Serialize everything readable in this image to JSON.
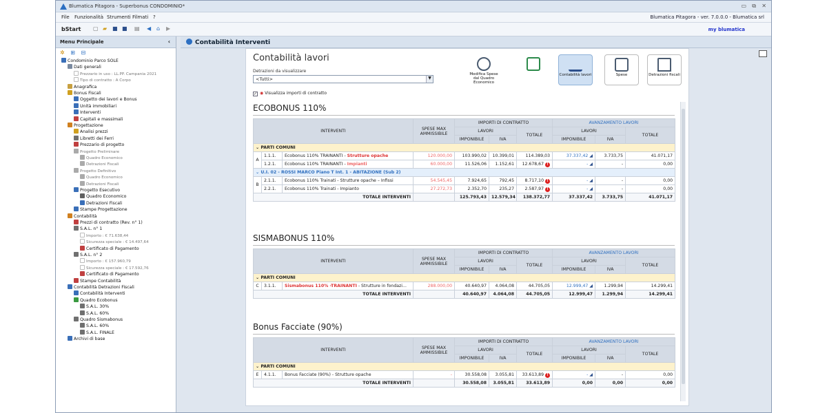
{
  "window": {
    "title": "Blumatica Pitagora - Superbonus CONDOMINIO*",
    "min": "▭",
    "restore": "⧉",
    "close": "✕"
  },
  "menu": {
    "items": [
      "File",
      "Funzionalità",
      "Strumenti",
      "Filmati",
      "?"
    ],
    "version": "Blumatica Pitagora - ver. 7.0.0.0 - Blumatica srl"
  },
  "toolbar": {
    "start_label": "bStart",
    "brand": "my blumatica"
  },
  "sidebar": {
    "title": "Menu Principale",
    "tree": [
      {
        "t": "Condominio Parco SOLE",
        "d": 0,
        "c": "#3a6fb8"
      },
      {
        "t": "Dati generali",
        "d": 1,
        "c": "#7a8aa0"
      },
      {
        "t": "Prezzario in uso : LL.PP. Campania 2021",
        "d": 2,
        "dim": true
      },
      {
        "t": "Tipo di contratto : A Corpo",
        "d": 2,
        "dim": true
      },
      {
        "t": "Anagrafica",
        "d": 1,
        "c": "#c8a040"
      },
      {
        "t": "Bonus Fiscali",
        "d": 1,
        "c": "#d0a020"
      },
      {
        "t": "Oggetto dei lavori e Bonus",
        "d": 2,
        "c": "#3a6fb8"
      },
      {
        "t": "Unità immobiliari",
        "d": 2,
        "c": "#3a6fb8"
      },
      {
        "t": "Interventi",
        "d": 2,
        "c": "#3a6fb8"
      },
      {
        "t": "Capitali e massimali",
        "d": 2,
        "c": "#c04040"
      },
      {
        "t": "Progettazione",
        "d": 1,
        "c": "#d08020"
      },
      {
        "t": "Analisi prezzi",
        "d": 2,
        "c": "#d0a020"
      },
      {
        "t": "Libretti dei Ferri",
        "d": 2,
        "c": "#707070"
      },
      {
        "t": "Prezzario di progetto",
        "d": 2,
        "c": "#c04040"
      },
      {
        "t": "Progetto Preliminare",
        "d": 2,
        "dim": true,
        "c": "#aaa"
      },
      {
        "t": "Quadro Economico",
        "d": 3,
        "dim": true,
        "c": "#aaa"
      },
      {
        "t": "Detrazioni Fiscali",
        "d": 3,
        "dim": true,
        "c": "#aaa"
      },
      {
        "t": "Progetto Definitivo",
        "d": 2,
        "dim": true,
        "c": "#aaa"
      },
      {
        "t": "Quadro Economico",
        "d": 3,
        "dim": true,
        "c": "#aaa"
      },
      {
        "t": "Detrazioni Fiscali",
        "d": 3,
        "dim": true,
        "c": "#aaa"
      },
      {
        "t": "Progetto Esecutivo",
        "d": 2,
        "c": "#3a6fb8"
      },
      {
        "t": "Quadro Economico",
        "d": 3,
        "c": "#606060"
      },
      {
        "t": "Detrazioni Fiscali",
        "d": 3,
        "c": "#3a6fb8"
      },
      {
        "t": "Stampe Progettazione",
        "d": 2,
        "c": "#3a6fb8"
      },
      {
        "t": "Contabilità",
        "d": 1,
        "c": "#d08020"
      },
      {
        "t": "Prezzi di contratto (Rev. n° 1)",
        "d": 2,
        "c": "#c04040"
      },
      {
        "t": "S.A.L. n° 1",
        "d": 2,
        "c": "#707070"
      },
      {
        "t": "Importo : € 71.638,44",
        "d": 3,
        "dim": true
      },
      {
        "t": "Sicurezza speciale : € 14.497,64",
        "d": 3,
        "dim": true
      },
      {
        "t": "Certificato di Pagamento",
        "d": 3,
        "c": "#c04040"
      },
      {
        "t": "S.A.L. n° 2",
        "d": 2,
        "c": "#707070"
      },
      {
        "t": "Importo : € 157.960,79",
        "d": 3,
        "dim": true
      },
      {
        "t": "Sicurezza speciale : € 17.592,76",
        "d": 3,
        "dim": true
      },
      {
        "t": "Certificato di Pagamento",
        "d": 3,
        "c": "#c04040"
      },
      {
        "t": "Stampe Contabilità",
        "d": 2,
        "c": "#c04040"
      },
      {
        "t": "Contabilità Detrazioni Fiscali",
        "d": 1,
        "c": "#3a6fb8"
      },
      {
        "t": "Contabilità Interventi",
        "d": 2,
        "c": "#3a6fb8"
      },
      {
        "t": "Quadro Ecobonus",
        "d": 2,
        "c": "#3a9a40"
      },
      {
        "t": "S.A.L. 30%",
        "d": 3,
        "c": "#707070"
      },
      {
        "t": "S.A.L. 60%",
        "d": 3,
        "c": "#707070"
      },
      {
        "t": "Quadro Sismabonus",
        "d": 2,
        "c": "#707070"
      },
      {
        "t": "S.A.L. 60%",
        "d": 3,
        "c": "#707070"
      },
      {
        "t": "S.A.L. FINALE",
        "d": 3,
        "c": "#707070"
      },
      {
        "t": "Archivi di base",
        "d": 1,
        "c": "#3a6fb8"
      }
    ]
  },
  "main": {
    "header": "Contabilità Interventi",
    "title": "Contabilità lavori",
    "detrazioni_label": "Detrazioni da visualizzare",
    "detrazioni_value": "<Tutti>",
    "show_contract": "Visualizza importi di contratto",
    "tools": [
      {
        "label": "Modifica Spese dal Quadro Economico"
      },
      {
        "label": ""
      },
      {
        "label": "Contabilità lavori",
        "selected": true
      },
      {
        "label": "Spese"
      },
      {
        "label": "Detrazioni fiscali"
      }
    ]
  },
  "headers": {
    "interventi": "INTERVENTI",
    "spese_max": "SPESE MAX AMMISSIBILE",
    "importi": "IMPORTI DI CONTRATTO",
    "avanzamento": "AVANZAMENTO LAVORI",
    "lavori": "LAVORI",
    "imponibile": "IMPONIBILE",
    "iva": "IVA",
    "totale": "TOTALE",
    "totale_interventi": "TOTALE INTERVENTI"
  },
  "sections": [
    {
      "title": "ECOBONUS 110%",
      "groups": [
        {
          "label": "PARTI COMUNI",
          "kind": "yellow",
          "letter": "A",
          "rows": [
            {
              "code": "1.1.1.",
              "desc": "Ecobonus 110% TRAINANTI - ",
              "desc2": "Strutture opache",
              "c2": "red",
              "max": "120.000,00",
              "imp": "103.990,02",
              "iva": "10.399,01",
              "tot": "114.389,03",
              "warn": false,
              "aimp": "37.337,42",
              "aiva": "3.733,75",
              "atot": "41.071,17"
            },
            {
              "code": "1.2.1.",
              "desc": "Ecobonus 110% TRAINANTI - ",
              "desc2": "Impianti",
              "c2": "pink",
              "max": "60.000,00",
              "imp": "11.526,06",
              "iva": "1.152,61",
              "tot": "12.678,67",
              "warn": true,
              "aimp": "-",
              "aiva": "-",
              "atot": "0,00"
            }
          ]
        },
        {
          "label": "U.I. 02 - ROSSI MARCO Piano T Int. 1 - ABITAZIONE (Sub 2)",
          "kind": "blue",
          "letter": "B",
          "rows": [
            {
              "code": "2.1.1.",
              "desc": "Ecobonus 110% Trainati - Strutture opache – Infissi",
              "desc2": "",
              "c2": "",
              "max": "54.545,45",
              "imp": "7.924,65",
              "iva": "792,45",
              "tot": "8.717,10",
              "warn": true,
              "aimp": "-",
              "aiva": "-",
              "atot": "0,00"
            },
            {
              "code": "2.2.1.",
              "desc": "Ecobonus 110% Trainati - Impianto",
              "desc2": "",
              "c2": "",
              "max": "27.272,73",
              "imp": "2.352,70",
              "iva": "235,27",
              "tot": "2.587,97",
              "warn": true,
              "aimp": "-",
              "aiva": "-",
              "atot": "0,00"
            }
          ]
        }
      ],
      "total": {
        "imp": "125.793,43",
        "iva": "12.579,34",
        "tot": "138.372,77",
        "aimp": "37.337,42",
        "aiva": "3.733,75",
        "atot": "41.071,17"
      }
    },
    {
      "title": "SISMABONUS 110%",
      "groups": [
        {
          "label": "PARTI COMUNI",
          "kind": "yellow",
          "letter": "C",
          "rows": [
            {
              "code": "3.1.1.",
              "desc": "",
              "desc2": "Sismabonus 110% -TRAINANTI",
              "c2": "red",
              "desc3": " - Strutture in fondazi...",
              "max": "288.000,00",
              "imp": "40.640,97",
              "iva": "4.064,08",
              "tot": "44.705,05",
              "warn": false,
              "aimp": "12.999,47",
              "aiva": "1.299,94",
              "atot": "14.299,41"
            }
          ]
        }
      ],
      "total": {
        "imp": "40.640,97",
        "iva": "4.064,08",
        "tot": "44.705,05",
        "aimp": "12.999,47",
        "aiva": "1.299,94",
        "atot": "14.299,41"
      }
    },
    {
      "title": "Bonus Facciate (90%)",
      "groups": [
        {
          "label": "PARTI COMUNI",
          "kind": "yellow",
          "letter": "E",
          "rows": [
            {
              "code": "4.1.1.",
              "desc": "Bonus Facciate (90%) - Strutture opache",
              "desc2": "",
              "c2": "",
              "max": "-",
              "imp": "30.558,08",
              "iva": "3.055,81",
              "tot": "33.613,89",
              "warn": true,
              "aimp": "-",
              "aiva": "-",
              "atot": "0,00"
            }
          ]
        }
      ],
      "total": {
        "imp": "30.558,08",
        "iva": "3.055,81",
        "tot": "33.613,89",
        "aimp": "0,00",
        "aiva": "0,00",
        "atot": "0,00"
      }
    }
  ]
}
